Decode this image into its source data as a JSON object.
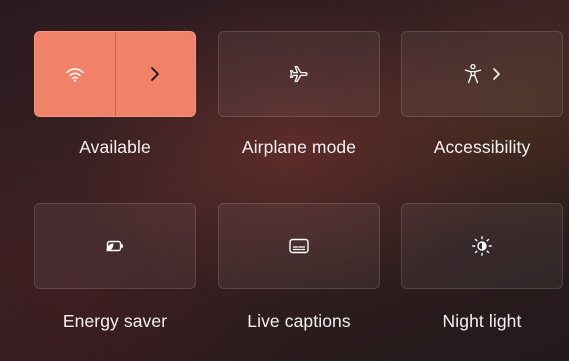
{
  "quick_settings": {
    "tiles": [
      {
        "label": "Available",
        "icon": "wifi-icon",
        "secondary_icon": "chevron-right-icon",
        "state": "on"
      },
      {
        "label": "Airplane mode",
        "icon": "airplane-icon",
        "state": "off"
      },
      {
        "label": "Accessibility",
        "icon": "accessibility-icon",
        "secondary_icon": "chevron-right-icon",
        "state": "off"
      },
      {
        "label": "Energy saver",
        "icon": "energy-saver-icon",
        "state": "off"
      },
      {
        "label": "Live captions",
        "icon": "captions-icon",
        "state": "off"
      },
      {
        "label": "Night light",
        "icon": "night-light-icon",
        "state": "off"
      }
    ]
  },
  "colors": {
    "accent": "#f0826a",
    "tile_off": "#3a2628",
    "text": "#ffffff"
  }
}
